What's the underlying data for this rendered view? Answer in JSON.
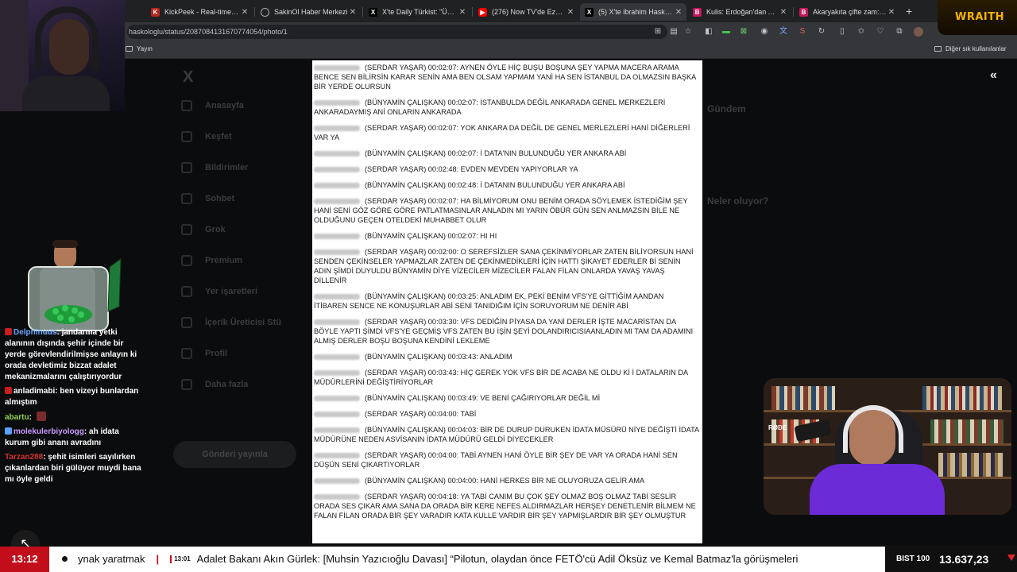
{
  "browser": {
    "tabs": [
      {
        "title": "KickPeek - Real-time URL Ch",
        "favicon": "kickpeek",
        "color": "#b3261e"
      },
      {
        "title": "SakinOl Haber Merkezi",
        "favicon": "globe",
        "color": "#888888"
      },
      {
        "title": "X'te Daily Türkist: \"Ümit Öz...",
        "favicon": "x",
        "color": "#000000"
      },
      {
        "title": "(276) Now TV'de Ezgi Gözey...",
        "favicon": "youtube",
        "color": "#ff0000"
      },
      {
        "title": "(5) X'te ibrahim Haskoloğlu:...",
        "favicon": "x",
        "color": "#000000"
      },
      {
        "title": "Kulis: Erdoğan'dan AKP'li ve...",
        "favicon": "b",
        "color": "#c2185b"
      },
      {
        "title": "Akaryakıta çifte zam: Benzin...",
        "favicon": "b",
        "color": "#c2185b"
      }
    ],
    "new_tab": "+",
    "url": "haskologlu/status/2087084131670774054/photo/1",
    "bookmarks": {
      "left": "Yayın",
      "right": "Diğer sık kullanılanlar"
    }
  },
  "x_page": {
    "logo": "X",
    "nav": [
      "Anasayfa",
      "Keşfet",
      "Bildirimler",
      "Sohbet",
      "Grok",
      "Premium",
      "Yer işaretleri",
      "İçerik Üreticisi Stü",
      "Profil",
      "Daha fazla"
    ],
    "post_button": "Gönderi yayınla",
    "right_faded": [
      "Gündem",
      "Neler oluyor?"
    ]
  },
  "document": {
    "entries": [
      {
        "text": "(SERDAR YAŞAR) 00:02:07:  AYNEN ÖYLE HİÇ BUŞU BOŞUNA ŞEY YAPMA MACERA ARAMA BENCE SEN BİLİRSİN KARAR SENİN AMA BEN OLSAM YAPMAM YANİ HA SEN İSTANBUL DA OLMAZSIN BAŞKA BİR YERDE OLURSUN"
      },
      {
        "text": "(BÜNYAMİN ÇALIŞKAN) 00:02:07:  İSTANBULDA DEĞİL ANKARADA GENEL MERKEZLERİ ANKARADAYMIŞ ANİ ONLARIN ANKARADA"
      },
      {
        "text": "(SERDAR YAŞAR) 00:02:07:  YOK ANKARA DA DEĞİL DE GENEL MERLEZLERİ HANİ DİĞERLERİ VAR YA"
      },
      {
        "text": "(BÜNYAMİN ÇALIŞKAN) 00:02:07:  İ DATA'NIN BULUNDUĞU YER ANKARA ABİ"
      },
      {
        "text": "(SERDAR YAŞAR) 00:02:48:  EVDEN MEVDEN YAPIYORLAR YA"
      },
      {
        "text": "(BÜNYAMİN ÇALIŞKAN) 00:02:48:  İ DATANIN BULUNDUĞU YER ANKARA ABİ"
      },
      {
        "text": "(SERDAR YAŞAR) 00:02:07: HA BİLMİYORUM ONU BENİM ORADA SÖYLEMEK İSTEDİĞİM ŞEY HANİ SENİ GÖZ GÖRE GÖRE PATLATMASINLAR ANLADIN MI YARIN ÖBÜR GÜN SEN ANLMAZSIN BİLE NE OLDUĞUNU GEÇEN OTELDEKİ MUHABBET OLUR"
      },
      {
        "text": "(BÜNYAMİN ÇALIŞKAN) 00:02:07:  HI HI"
      },
      {
        "text": "(SERDAR YAŞAR) 00:02:00:  O SEREFSİZLER SANA ÇEKİNMİYORLAR ZATEN BİLİYORSUN HANİ SENDEN ÇEKİNSELER YAPMAZLAR ZATEN DE ÇEKİNMEDİKLERİ İÇİN HATTI ŞİKAYET EDERLER Bİ SENİN ADIN ŞİMDİ DUYULDU BÜNYAMİN DİYE VİZECİLER MİZECİLER FALAN FİLAN ONLARDA YAVAŞ YAVAŞ DİLLENİR"
      },
      {
        "text": "(BÜNYAMİN ÇALIŞKAN) 00:03:25:  ANLADIM EK, PEKİ BENİM VFS'YE GİTTİĞİM AANDAN İTİBAREN SENCE NE KONUŞURLAR ABİ SENİ TANIDIĞIM İÇİN SORUYORUM NE DENİR ABİ"
      },
      {
        "text": "(SERDAR YAŞAR) 00:03:30:  VFS DEDİĞİN PİYASA DA YANİ DERLER İŞTE MACARİSTAN DA BÖYLE YAPTI ŞİMDİ VFS'YE GEÇMİŞ VFS ZATEN BU İŞİN ŞEYİ DOLANDIRICISIAANLADIN MI TAM DA ADAMINI ALMIŞ DERLER BOŞU BOŞUNA KENDİNİ LEKLEME"
      },
      {
        "text": "(BÜNYAMİN ÇALIŞKAN) 00:03:43:  ANLADIM"
      },
      {
        "text": "(SERDAR YAŞAR) 00:03:43:  HİÇ GEREK YOK VFS BİR DE ACABA NE OLDU Kİ İ DATALARIN DA MÜDÜRLERİNİ DEĞİŞTİRİYORLAR"
      },
      {
        "text": "(BÜNYAMİN ÇALIŞKAN) 00:03:49:  VE BENİ ÇAĞIRIYORLAR DEĞİL Mİ"
      },
      {
        "text": "(SERDAR YAŞAR) 00:04:00:  TABİ"
      },
      {
        "text": "(BÜNYAMİN ÇALIŞKAN) 00:04:03:  BİR DE DURUP DURUKEN İDATA MÜSÜRÜ NİYE DEĞİŞTİ İDATA MÜDÜRÜNE NEDEN ASVİSANIN İDATA MÜDÜRÜ GELDİ DİYECEKLER"
      },
      {
        "text": "(SERDAR YAŞAR) 00:04:00:  TABİ AYNEN HANİ ÖYLE BİR ŞEY DE VAR YA ORADA HANİ SEN DÜŞÜN SENİ ÇIKARTIYORLAR"
      },
      {
        "text": "(BÜNYAMİN ÇALIŞKAN) 00:04:00:  HANİ HERKES BİR NE OLUYORUZA GELİR AMA"
      },
      {
        "text": "(SERDAR YAŞAR) 00:04:18:  YA TABİ CANIM  BU ÇOK ŞEY OLMAZ BOŞ OLMAZ TABİ SESLİR ORADA SES ÇIKAR AMA SANA DA ORADA BİR KERE NEFES ALDIRMAZLAR HERŞEY DENETLENİR BİLMEM NE FALAN FİLAN ORADA BİR ŞEY VARADIR KATA KULLE VARDIR BİR ŞEY YAPMIŞLARDIR BİR ŞEY OLMUŞTUR"
      }
    ]
  },
  "stream": {
    "wraith_logo": "WRAITH",
    "mic_label": "RØDE",
    "chat": [
      {
        "user": "Delphinuus",
        "user_color": "#6aa7ff",
        "badge": "#c81e1e",
        "text": "jandarma yetki alanının dışında şehir içinde bir yerde görevlendirilmişse anlayın ki orada devletimiz bizzat adalet mekanizmalarını çalıştırıyordur"
      },
      {
        "user": "anladimabi",
        "user_color": "#ffffff",
        "badge": "#c81e1e",
        "text": "ben vizeyi bunlardan almıştım"
      },
      {
        "user": "abartu",
        "user_color": "#8fd14f",
        "badge": "",
        "text": ""
      },
      {
        "user": "molekulerbiyologg",
        "user_color": "#c89bff",
        "badge": "#5aa0ff",
        "text": "ah idata kurum gibi ananı avradını"
      },
      {
        "user": "Tarzan288",
        "user_color": "#d23232",
        "badge": "",
        "text": "şehit isimleri sayılırken çıkanlardan biri gülüyor muydi bana mı öyle geldi"
      }
    ]
  },
  "ticker": {
    "clock": "13:12",
    "prev_headline": "ynak yaratmak",
    "item_time": "13:01",
    "headline": "Adalet Bakanı Akın Gürlek: [Muhsin Yazıcıoğlu Davası] “Pilotun, olaydan önce FETÖ'cü Adil Öksüz ve Kemal Batmaz'la görüşmeleri",
    "index_label": "BIST 100",
    "index_value": "13.637,23",
    "index_direction": "down",
    "down_color": "#e32626"
  }
}
